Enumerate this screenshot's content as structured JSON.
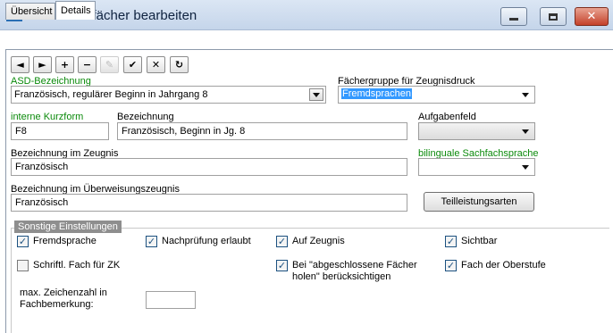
{
  "window": {
    "title": "Unterrichtsfächer bearbeiten",
    "controls": {
      "min": "–",
      "max": "□",
      "close": "✕"
    }
  },
  "tabs": [
    {
      "label": "Übersicht",
      "active": false
    },
    {
      "label": "Details",
      "active": true
    }
  ],
  "toolbar": {
    "buttons": [
      {
        "name": "prev-record",
        "glyph": "◄"
      },
      {
        "name": "next-record",
        "glyph": "►"
      },
      {
        "name": "add-record",
        "glyph": "+"
      },
      {
        "name": "delete-record",
        "glyph": "−"
      },
      {
        "name": "edit-record",
        "glyph": "✎",
        "disabled": true
      },
      {
        "name": "confirm-record",
        "glyph": "✔"
      },
      {
        "name": "cancel-record",
        "glyph": "✕"
      },
      {
        "name": "refresh-record",
        "glyph": "↻"
      }
    ]
  },
  "form": {
    "asd": {
      "label": "ASD-Bezeichnung",
      "value": "Französisch, regulärer Beginn in Jahrgang 8"
    },
    "faechergruppe": {
      "label": "Fächergruppe für Zeugnisdruck",
      "value": "Fremdsprachen"
    },
    "kurzform": {
      "label": "interne Kurzform",
      "value": "F8"
    },
    "bezeichnung": {
      "label": "Bezeichnung",
      "value": "Französisch, Beginn in Jg. 8"
    },
    "aufgabenfeld": {
      "label": "Aufgabenfeld",
      "value": ""
    },
    "zeugnis": {
      "label": "Bezeichnung im Zeugnis",
      "value": "Französisch"
    },
    "bilingual": {
      "label": "bilinguale Sachfachsprache",
      "value": ""
    },
    "ueberweisung": {
      "label": "Bezeichnung im Überweisungszeugnis",
      "value": "Französisch"
    },
    "teilleistungen_button": "Teilleistungsarten"
  },
  "sonstige": {
    "title": "Sonstige Einstellungen",
    "checkboxes": {
      "fremdsprache": {
        "label": "Fremdsprache",
        "checked": true
      },
      "nachpruefung": {
        "label": "Nachprüfung erlaubt",
        "checked": true
      },
      "auf_zeugnis": {
        "label": "Auf Zeugnis",
        "checked": true
      },
      "sichtbar": {
        "label": "Sichtbar",
        "checked": true
      },
      "schriftl_zk": {
        "label": "Schriftl. Fach für ZK",
        "checked": false
      },
      "abgeschlossen": {
        "label": "Bei \"abgeschlossene Fächer holen\" berücksichtigen",
        "checked": true
      },
      "oberstufe": {
        "label": "Fach der Oberstufe",
        "checked": true
      }
    },
    "zeichenzahl": {
      "label": "max. Zeichenzahl in Fachbemerkung:",
      "value": ""
    }
  },
  "colors": {
    "green_label": "#0b8a0b",
    "selection": "#3399ff",
    "title_bar": "#c5d5ea"
  }
}
